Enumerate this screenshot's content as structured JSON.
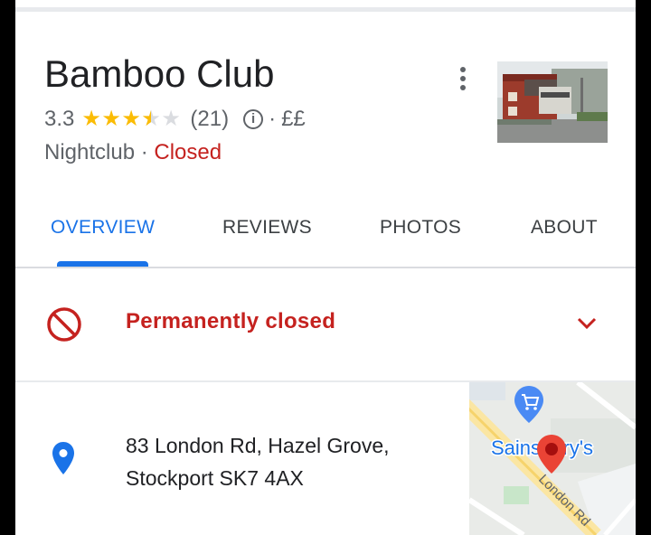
{
  "place": {
    "name": "Bamboo Club",
    "rating": "3.3",
    "rating_value": 3.3,
    "review_count": "(21)",
    "price_sep": "·",
    "price": "££",
    "category": "Nightclub",
    "category_sep": " · ",
    "status": "Closed"
  },
  "tabs": [
    {
      "label": "OVERVIEW",
      "active": true
    },
    {
      "label": "REVIEWS",
      "active": false
    },
    {
      "label": "PHOTOS",
      "active": false
    },
    {
      "label": "ABOUT",
      "active": false
    }
  ],
  "closed_banner": {
    "text": "Permanently closed"
  },
  "address": {
    "line1": "83 London Rd, Hazel Grove,",
    "line2": "Stockport SK7 4AX"
  },
  "map": {
    "poi_label": "Sainsbury's",
    "road_label": "London Rd"
  },
  "colors": {
    "accent": "#1a73e8",
    "closed": "#c5221f",
    "star": "#fbbc04",
    "text_secondary": "#5f6368"
  },
  "icons": {
    "more": "more-vert-icon",
    "info": "info-icon",
    "closed": "block-icon",
    "expand": "chevron-down-icon",
    "location": "location-pin-icon"
  }
}
